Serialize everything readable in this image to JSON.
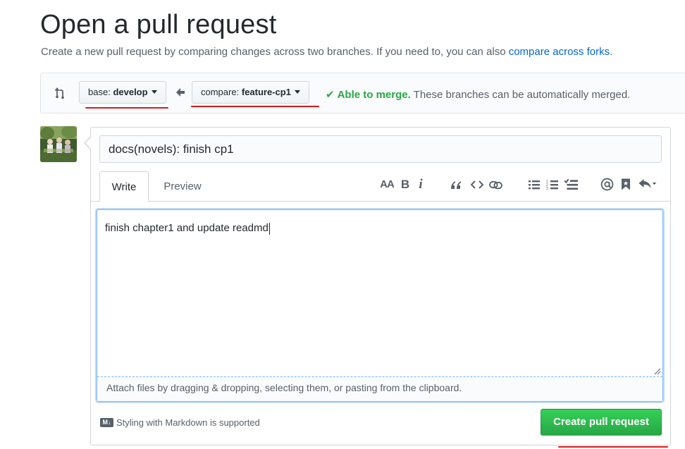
{
  "header": {
    "title": "Open a pull request",
    "subtitle": "Create a new pull request by comparing changes across two branches. If you need to, you can also ",
    "subtitle_link": "compare across forks",
    "subtitle_end": "."
  },
  "range": {
    "base_prefix": "base:",
    "base_branch": "develop",
    "compare_prefix": "compare:",
    "compare_branch": "feature-cp1",
    "merge_ok": "Able to merge.",
    "merge_text": "These branches can be automatically merged."
  },
  "form": {
    "title_value": "docs(novels): finish cp1",
    "tabs": {
      "write": "Write",
      "preview": "Preview"
    },
    "toolbar": {
      "heading": "AA",
      "bold": "B",
      "italic": "i"
    },
    "body_value": "finish chapter1 and update readmd",
    "attach_hint": "Attach files by dragging & dropping, selecting them, or pasting from the clipboard.",
    "markdown_badge": "M↓",
    "markdown_note": "Styling with Markdown is supported",
    "submit_label": "Create pull request"
  },
  "colors": {
    "accent_link": "#0366d6",
    "success": "#28a745",
    "annotation": "#d7191c"
  }
}
